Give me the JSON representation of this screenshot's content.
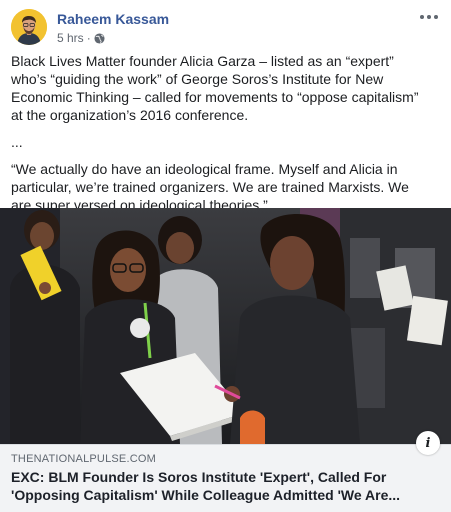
{
  "post": {
    "author": "Raheem Kassam",
    "time": "5 hrs",
    "separator": "·",
    "privacy_icon": "globe-icon",
    "more_icon": "more-options-icon",
    "paragraphs": [
      "Black Lives Matter founder Alicia Garza – listed as an “expert” who’s “guiding the work” of George Soros’s Institute for New Economic Thinking – called for movements to “oppose capitalism” at the organization’s 2016 conference.",
      "...",
      "“We actually do have an ideological frame. Myself and Alicia in particular, we’re trained organizers. We are trained Marxists. We are super versed on ideological theories.”"
    ]
  },
  "link_preview": {
    "domain": "THENATIONALPULSE.COM",
    "title": "EXC: BLM Founder Is Soros Institute 'Expert', Called For 'Opposing Capitalism' While Colleague Admitted 'We Are...",
    "info_label": "i"
  },
  "colors": {
    "author_link": "#385898",
    "meta_text": "#606770",
    "preview_bg": "#f2f3f5",
    "avatar_bg": "#f2c230"
  }
}
